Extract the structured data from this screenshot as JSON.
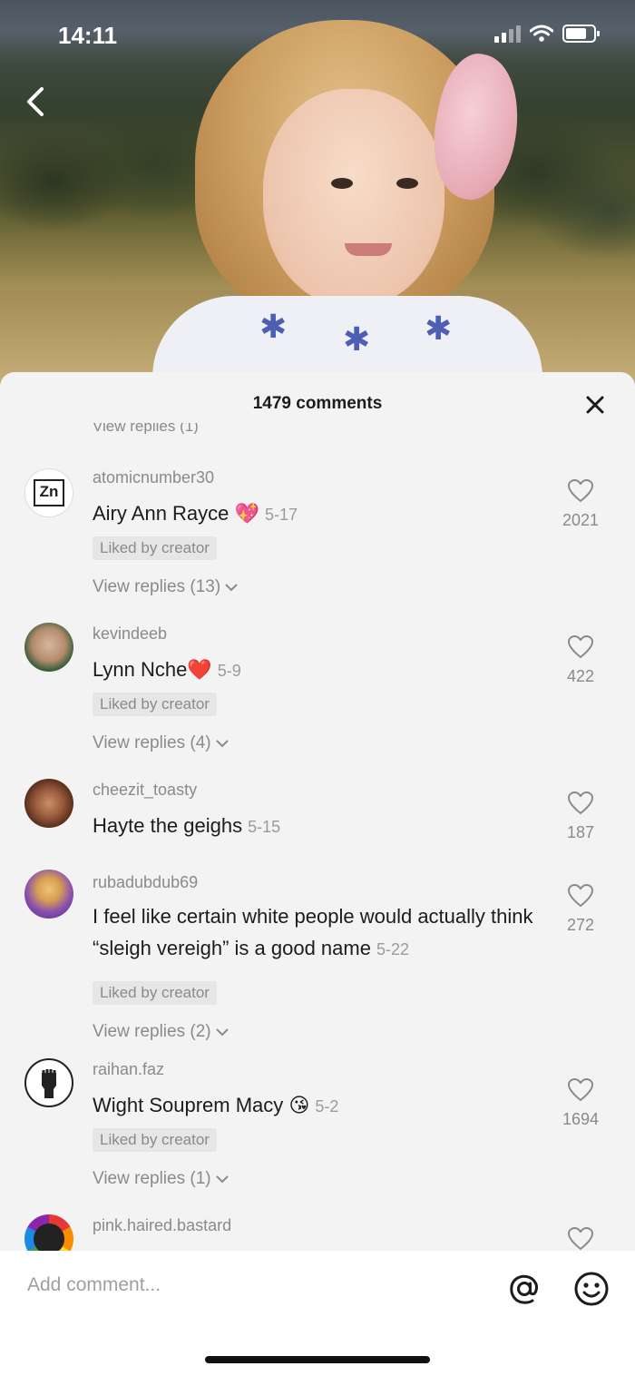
{
  "status_bar": {
    "time": "14:11"
  },
  "sheet": {
    "title": "1479 comments",
    "cut_replies_label": "View replies (1)"
  },
  "comments": [
    {
      "username": "atomicnumber30",
      "text": "Airy Ann Rayce",
      "emoji": "💖",
      "date": "5-17",
      "likes": "2021",
      "liked_by_creator": "Liked by creator",
      "view_replies": "View replies (13)",
      "avatar_text": "Zn"
    },
    {
      "username": "kevindeeb",
      "text": "Lynn Nche",
      "emoji": "❤️",
      "date": "5-9",
      "likes": "422",
      "liked_by_creator": "Liked by creator",
      "view_replies": "View replies (4)"
    },
    {
      "username": "cheezit_toasty",
      "text": "Hayte the geighs",
      "date": "5-15",
      "likes": "187"
    },
    {
      "username": "rubadubdub69",
      "text": "I feel like certain white people would actually think “sleigh vereigh” is a good name",
      "date": "5-22",
      "likes": "272",
      "liked_by_creator": "Liked by creator",
      "view_replies": "View replies (2)"
    },
    {
      "username": "raihan.faz",
      "text": "Wight Souprem Macy",
      "emoji": "😘",
      "date": "5-2",
      "likes": "1694",
      "liked_by_creator": "Liked by creator",
      "view_replies": "View replies (1)"
    },
    {
      "username": "pink.haired.bastard"
    }
  ],
  "input": {
    "placeholder": "Add comment..."
  },
  "icons": {
    "back": "chevron-left-icon",
    "close": "close-icon",
    "like": "heart-outline-icon",
    "mention": "at-icon",
    "emoji": "smiley-icon"
  },
  "colors": {
    "sheet_bg": "#f3f3f4",
    "text": "#1c1c1c",
    "muted": "#8a8a8a"
  }
}
